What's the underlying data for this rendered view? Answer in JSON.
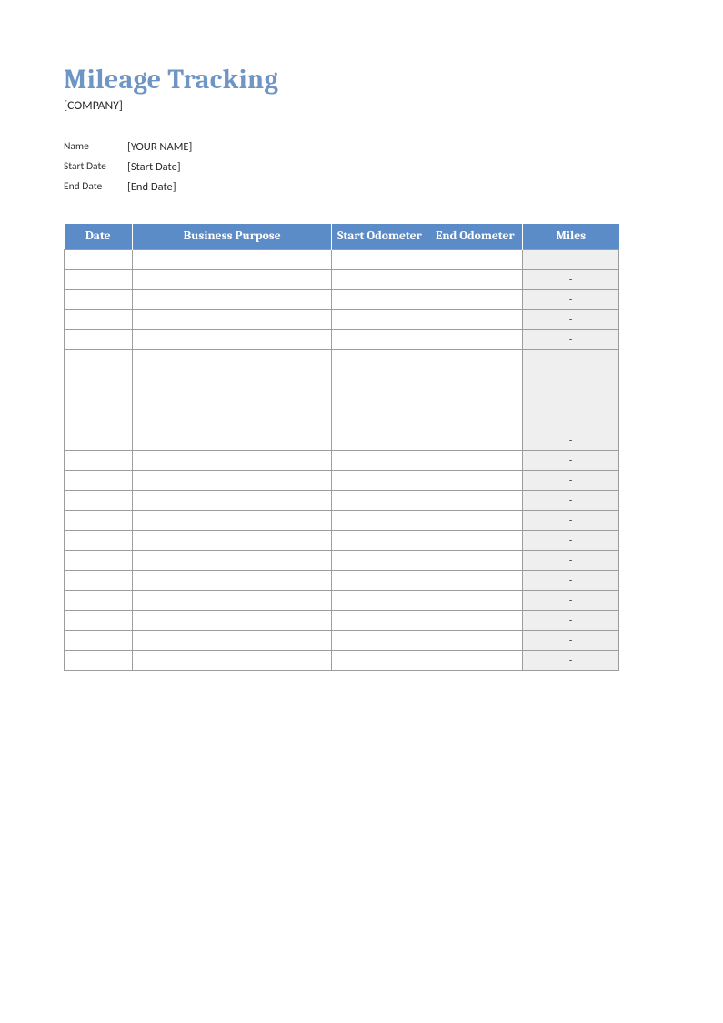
{
  "header": {
    "title": "Mileage Tracking",
    "company": "[COMPANY]"
  },
  "info": {
    "name_label": "Name",
    "name_value": "[YOUR NAME]",
    "start_label": "Start Date",
    "start_value": "[Start Date]",
    "end_label": "End Date",
    "end_value": "[End Date]"
  },
  "table": {
    "columns": {
      "date": "Date",
      "purpose": "Business Purpose",
      "start_odo": "Start Odometer",
      "end_odo": "End Odometer",
      "miles": "Miles"
    },
    "rows": [
      {
        "date": "",
        "purpose": "",
        "start_odo": "",
        "end_odo": "",
        "miles": ""
      },
      {
        "date": "",
        "purpose": "",
        "start_odo": "",
        "end_odo": "",
        "miles": "-"
      },
      {
        "date": "",
        "purpose": "",
        "start_odo": "",
        "end_odo": "",
        "miles": "-"
      },
      {
        "date": "",
        "purpose": "",
        "start_odo": "",
        "end_odo": "",
        "miles": "-"
      },
      {
        "date": "",
        "purpose": "",
        "start_odo": "",
        "end_odo": "",
        "miles": "-"
      },
      {
        "date": "",
        "purpose": "",
        "start_odo": "",
        "end_odo": "",
        "miles": "-"
      },
      {
        "date": "",
        "purpose": "",
        "start_odo": "",
        "end_odo": "",
        "miles": "-"
      },
      {
        "date": "",
        "purpose": "",
        "start_odo": "",
        "end_odo": "",
        "miles": "-"
      },
      {
        "date": "",
        "purpose": "",
        "start_odo": "",
        "end_odo": "",
        "miles": "-"
      },
      {
        "date": "",
        "purpose": "",
        "start_odo": "",
        "end_odo": "",
        "miles": "-"
      },
      {
        "date": "",
        "purpose": "",
        "start_odo": "",
        "end_odo": "",
        "miles": "-"
      },
      {
        "date": "",
        "purpose": "",
        "start_odo": "",
        "end_odo": "",
        "miles": "-"
      },
      {
        "date": "",
        "purpose": "",
        "start_odo": "",
        "end_odo": "",
        "miles": "-"
      },
      {
        "date": "",
        "purpose": "",
        "start_odo": "",
        "end_odo": "",
        "miles": "-"
      },
      {
        "date": "",
        "purpose": "",
        "start_odo": "",
        "end_odo": "",
        "miles": "-"
      },
      {
        "date": "",
        "purpose": "",
        "start_odo": "",
        "end_odo": "",
        "miles": "-"
      },
      {
        "date": "",
        "purpose": "",
        "start_odo": "",
        "end_odo": "",
        "miles": "-"
      },
      {
        "date": "",
        "purpose": "",
        "start_odo": "",
        "end_odo": "",
        "miles": "-"
      },
      {
        "date": "",
        "purpose": "",
        "start_odo": "",
        "end_odo": "",
        "miles": "-"
      },
      {
        "date": "",
        "purpose": "",
        "start_odo": "",
        "end_odo": "",
        "miles": "-"
      },
      {
        "date": "",
        "purpose": "",
        "start_odo": "",
        "end_odo": "",
        "miles": "-"
      }
    ]
  }
}
